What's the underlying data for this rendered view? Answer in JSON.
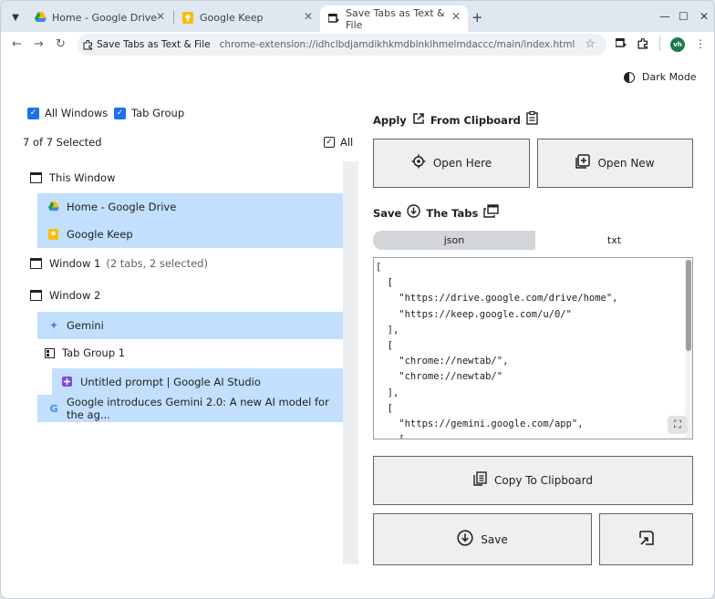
{
  "browser": {
    "tabs": [
      {
        "title": "Home - Google Drive"
      },
      {
        "title": "Google Keep"
      },
      {
        "title": "Save Tabs as Text & File"
      }
    ],
    "site_chip": "Save Tabs as Text & File",
    "url": "chrome-extension://idhclbdjamdikhkmdblnklhmelmdaccc/main/index.html",
    "avatar": "vh"
  },
  "header": {
    "dark_mode_label": "Dark Mode"
  },
  "filters": {
    "all_windows": "All Windows",
    "tab_group": "Tab Group"
  },
  "selection": {
    "count_label": "7 of 7 Selected",
    "all_label": "All"
  },
  "tree": {
    "this_window": "This Window",
    "this_window_tabs": [
      "Home - Google Drive",
      "Google Keep"
    ],
    "window1": "Window 1",
    "window1_info": "(2 tabs, 2 selected)",
    "window2": "Window 2",
    "window2_tab1": "Gemini",
    "group": "Tab Group 1",
    "group_tab": "Untitled prompt | Google AI Studio",
    "window2_tab2": "Google introduces Gemini 2.0: A new AI model for the ag..."
  },
  "apply": {
    "label": "Apply",
    "from_clipboard": "From Clipboard",
    "open_here": "Open Here",
    "open_new": "Open New"
  },
  "save": {
    "label": "Save",
    "the_tabs": "The Tabs",
    "format_json": "json",
    "format_txt": "txt",
    "code": "[\n  [\n    \"https://drive.google.com/drive/home\",\n    \"https://keep.google.com/u/0/\"\n  ],\n  [\n    \"chrome://newtab/\",\n    \"chrome://newtab/\"\n  ],\n  [\n    \"https://gemini.google.com/app\",\n    [",
    "copy_button": "Copy To Clipboard",
    "save_button": "Save"
  },
  "colors": {
    "selected_row": "#c2e0fd",
    "checkbox": "#1a73e8"
  }
}
